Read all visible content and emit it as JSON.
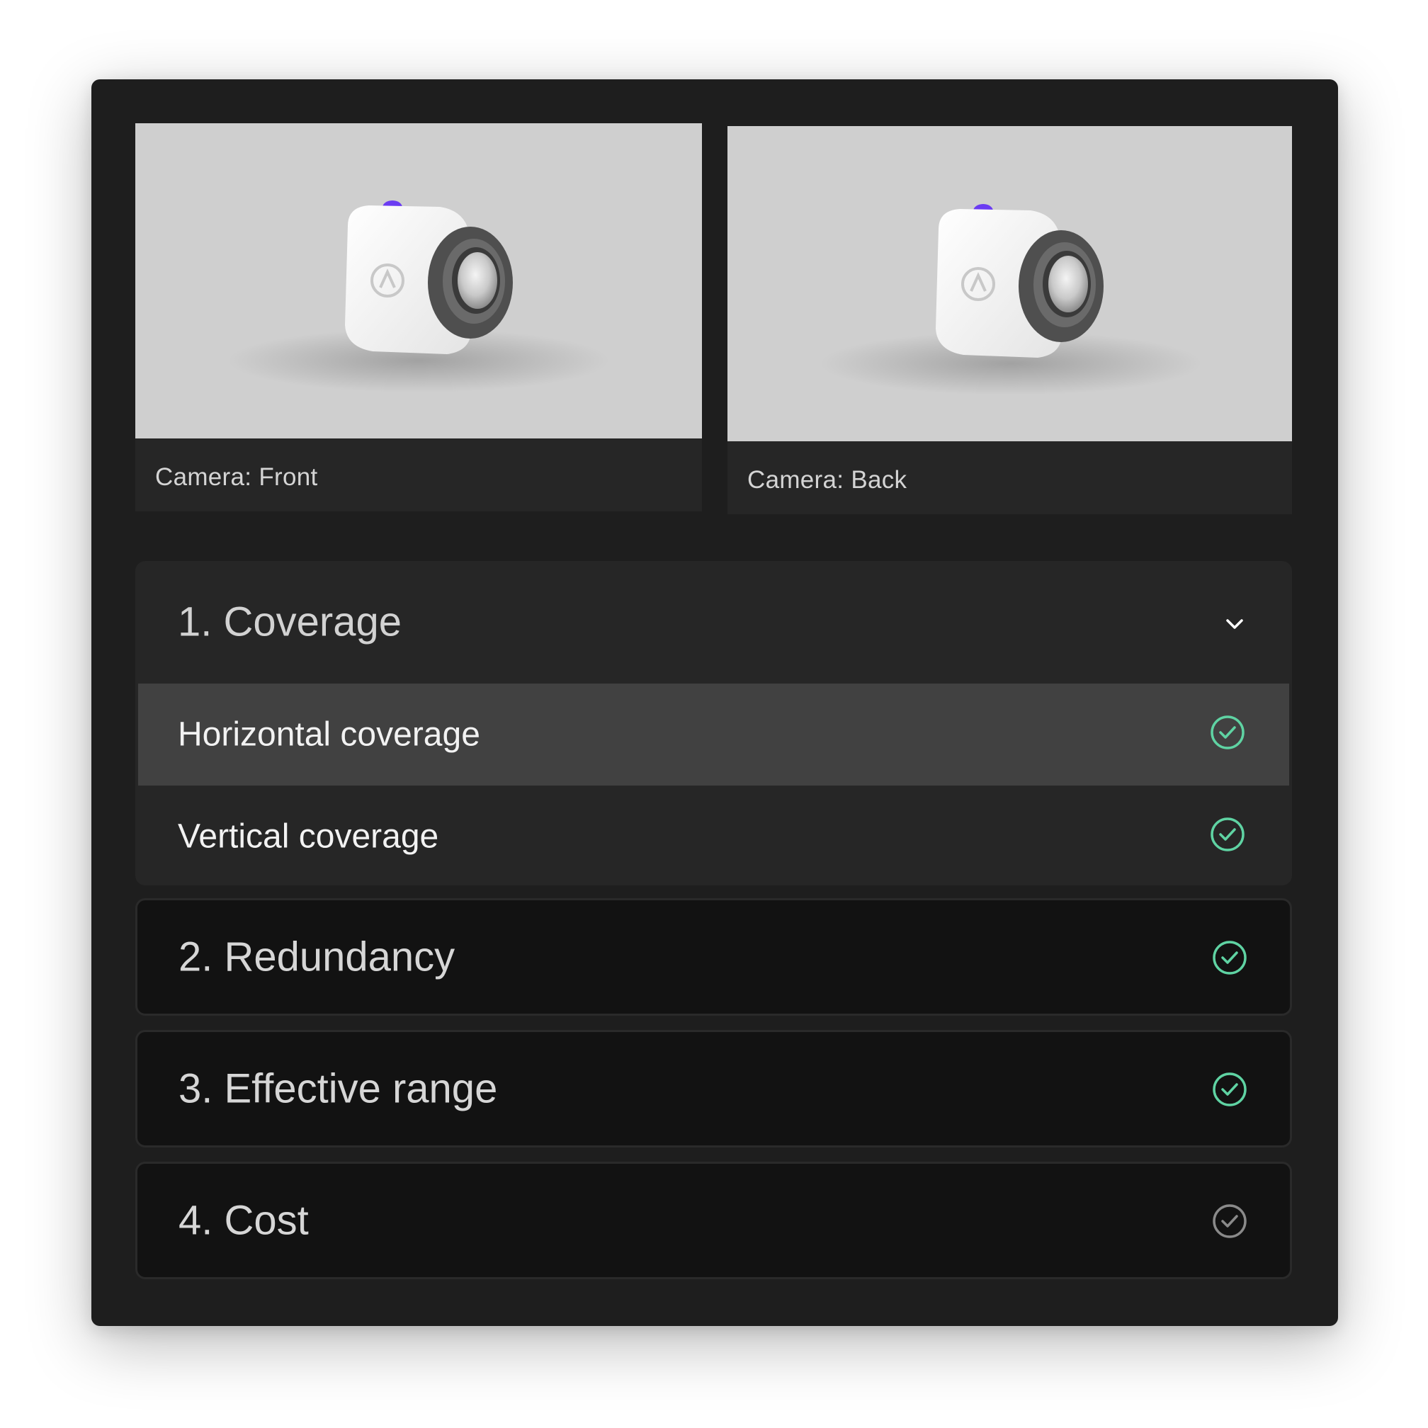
{
  "cameras": {
    "front": {
      "caption": "Camera: Front"
    },
    "back": {
      "caption": "Camera: Back"
    }
  },
  "sections": [
    {
      "title": "1. Coverage",
      "expanded": true,
      "toggle_icon": "chevron-down-icon",
      "items": [
        {
          "label": "Horizontal coverage",
          "complete": true,
          "selected": true
        },
        {
          "label": "Vertical coverage",
          "complete": true,
          "selected": false
        }
      ]
    },
    {
      "title": "2. Redundancy",
      "complete": true
    },
    {
      "title": "3. Effective range",
      "complete": true
    },
    {
      "title": "4. Cost",
      "complete": false
    }
  ],
  "colors": {
    "check_complete": "#5fd3a3",
    "check_pending": "#8a8a8a",
    "camera_accent": "#6b3cf2"
  }
}
